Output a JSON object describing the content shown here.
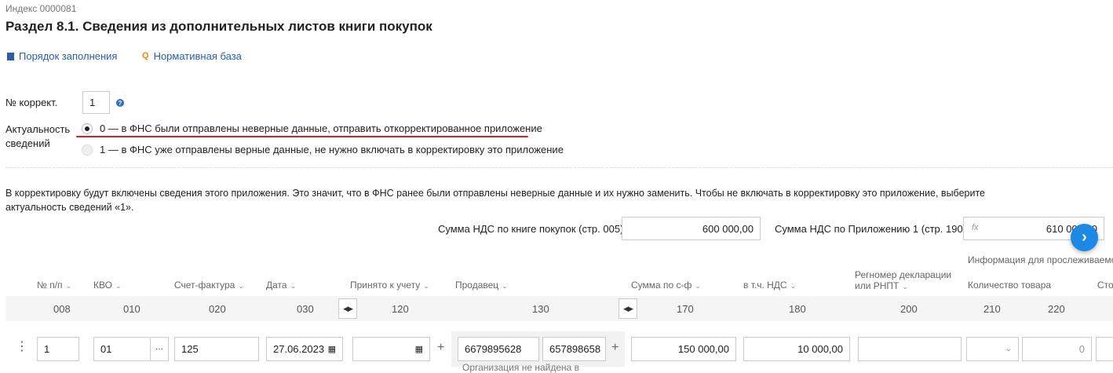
{
  "header": {
    "index": "Индекс 0000081",
    "title": "Раздел 8.1. Сведения из дополнительных листов книги покупок"
  },
  "links": {
    "fill_order": "Порядок заполнения",
    "normative": "Нормативная база"
  },
  "form": {
    "correction_label": "№ коррект.",
    "correction_value": "1",
    "help_symbol": "?",
    "actuality_label_1": "Актуальность",
    "actuality_label_2": "сведений",
    "option0": "0 — в ФНС были отправлены неверные данные, отправить откорректированное приложение",
    "option1": "1 — в ФНС уже отправлены верные данные, не нужно включать в корректировку это приложение",
    "selected_option": "0"
  },
  "info_text": "В корректировку будут включены сведения этого приложения. Это значит, что в ФНС ранее были отправлены неверные данные и их нужно заменить. Чтобы не включать в корректировку это приложение, выберите актуальность сведений «1».",
  "sums": {
    "book_label": "Сумма НДС по книге покупок (стр. 005)",
    "book_value": "600 000,00",
    "app_label": "Сумма НДС по Приложению 1 (стр. 190)",
    "app_fx": "fx",
    "app_value": "610 000,00"
  },
  "table": {
    "group_header": "Информация для прослеживаемости",
    "headers": {
      "npp": "№ п/п",
      "kvo": "КВО",
      "invoice": "Счет-фактура",
      "date": "Дата",
      "accepted": "Принято к учету",
      "seller": "Продавец",
      "sum": "Сумма по с-ф",
      "vat": "в т.ч. НДС",
      "regnum_1": "Регномер декларации",
      "regnum_2": "или РНПТ",
      "qty": "Количество товара",
      "cost": "Сто"
    },
    "codes": {
      "npp": "008",
      "kvo": "010",
      "invoice": "020",
      "date": "030",
      "accepted": "120",
      "seller": "130",
      "sum": "170",
      "vat": "180",
      "regnum": "200",
      "qty": "210",
      "c220": "220"
    },
    "row": {
      "npp": "1",
      "kvo": "01",
      "kvo_more": "···",
      "invoice": "125",
      "date": "27.06.2023",
      "seller_inn": "6679895628",
      "seller_kpp": "657898658",
      "seller_note": "Организация не найдена в",
      "sum": "150 000,00",
      "vat": "10 000,00",
      "qty": "0"
    }
  },
  "colors": {
    "link": "#2a5ea8",
    "underline_red": "#e31b1b",
    "fab_blue": "#1e88e5"
  }
}
